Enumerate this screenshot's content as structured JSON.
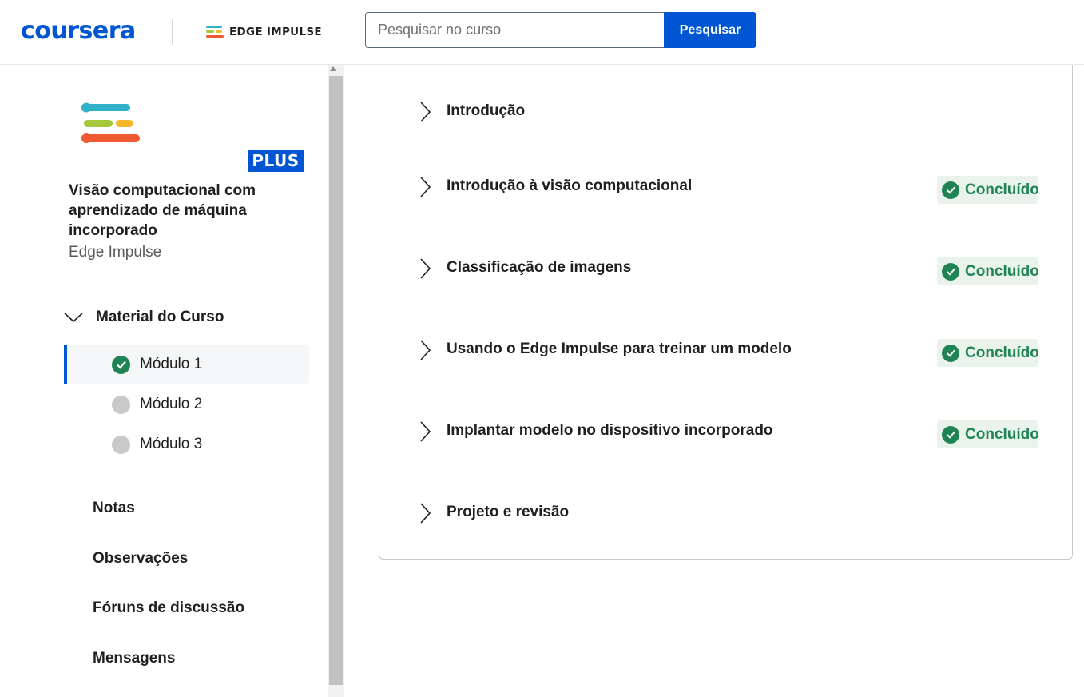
{
  "header": {
    "logo_text": "coursera",
    "partner_name": "EDGE IMPULSE",
    "search_placeholder": "Pesquisar no curso",
    "search_button": "Pesquisar"
  },
  "sidebar": {
    "plus_badge": "PLUS",
    "course_title": "Visão computacional com aprendizado de máquina incorporado",
    "course_partner": "Edge Impulse",
    "material_label": "Material do Curso",
    "modules": [
      {
        "label": "Módulo 1",
        "status": "completed"
      },
      {
        "label": "Módulo 2",
        "status": "not-started"
      },
      {
        "label": "Módulo 3",
        "status": "not-started"
      }
    ],
    "links": [
      "Notas",
      "Observações",
      "Fóruns de discussão",
      "Mensagens"
    ]
  },
  "lessons": [
    {
      "title": "Introdução",
      "badge": ""
    },
    {
      "title": "Introdução à visão computacional",
      "badge": "Concluído"
    },
    {
      "title": "Classificação de imagens",
      "badge": "Concluído"
    },
    {
      "title": "Usando o Edge Impulse para treinar um modelo",
      "badge": "Concluído"
    },
    {
      "title": "Implantar modelo no dispositivo incorporado",
      "badge": "Concluído"
    },
    {
      "title": "Projeto e revisão",
      "badge": ""
    }
  ],
  "colors": {
    "brand": "#0056d2",
    "success": "#1f8354",
    "success_bg": "#e9f3ec",
    "logo_teal": "#2fb2c9",
    "logo_green": "#a3c93a",
    "logo_yellow": "#f6b82a",
    "logo_orange": "#f05a32"
  }
}
